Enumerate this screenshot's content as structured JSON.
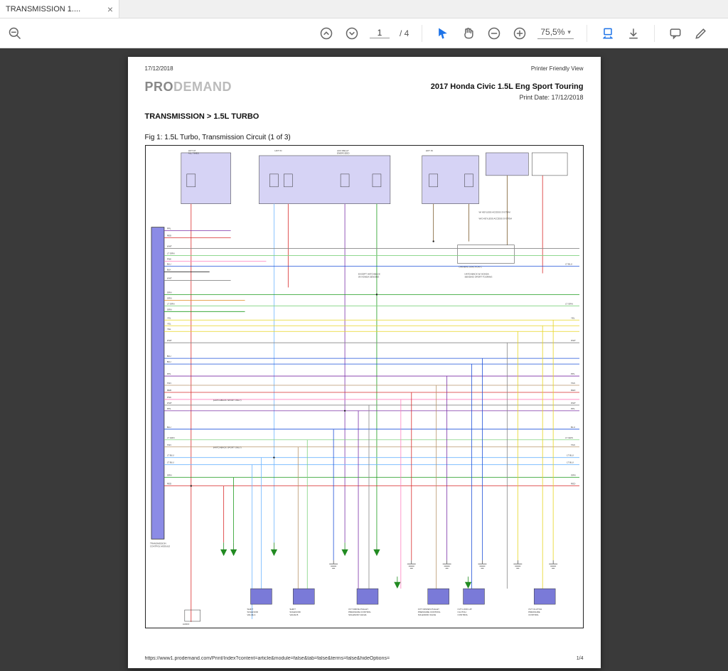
{
  "tab": {
    "label": "TRANSMISSION 1...."
  },
  "toolbar": {
    "page_current": "1",
    "page_total": "/ 4",
    "zoom": "75,5%"
  },
  "doc": {
    "date_top_left": "17/12/2018",
    "view_label": "Printer Friendly View",
    "brand_pro": "PRO",
    "brand_demand": "DEMAND",
    "vehicle": "2017 Honda Civic 1.5L Eng Sport Touring",
    "print_date": "Print Date: 17/12/2018",
    "section": "TRANSMISSION > 1.5L TURBO",
    "fig_title": "Fig 1: 1.5L Turbo, Transmission Circuit (1 of 3)",
    "footer_url": "https://www1.prodemand.com/Print/Index?content=article&module=false&tab=false&terms=false&hideOptions=",
    "footer_page": "1/4"
  },
  "diagram": {
    "top_labels": [
      "HOT AT ALL TIMES",
      "HOT IN",
      "ACC RELAY ENERGIZED",
      "HOT IN"
    ],
    "pcm_label": "TRANSMISSION CONTROL MODULE",
    "wire_colors": [
      "PPL",
      "RED",
      "WHT",
      "LT GRN",
      "PNK",
      "BLU",
      "BLK",
      "WHT",
      "GRN",
      "ORN",
      "LT GRN",
      "GRN",
      "YEL",
      "YEL",
      "YEL",
      "WHT",
      "BLU",
      "BLU",
      "PPL",
      "TAN",
      "RED",
      "PNK",
      "WHT",
      "PPL",
      "BLU",
      "LT GRN",
      "TAN",
      "LT BLU",
      "LT BLU",
      "GRN",
      "RED"
    ],
    "right_labels": [
      "LT GRN",
      "LT BLU",
      "GRN",
      "YEL",
      "YEL",
      "WHT",
      "PNK",
      "PPL",
      "TAN",
      "BLU",
      "RED",
      "WHT",
      "PPL",
      "BLU",
      "LT GRN",
      "TAN",
      "LT BLU",
      "LT BLU",
      "GRN",
      "RED"
    ],
    "bottom_components": [
      "SHIFT SOLENOID VALVE A",
      "SHIFT SOLENOID VALVE B",
      "CVT DRIVE PULLEY PRESSURE CONTROL",
      "CVT DRIVEN PULLEY PRESSURE CONTROL",
      "CVT LOCK-UP CLUTCH CONTROL",
      "CVT CLUTCH PRESSURE CONTROL"
    ],
    "note_hatchback": "(HATCHBACK SPORT ONLY)",
    "note_except": "EXCEPT HATCHBACK W/ HONDA SENSING",
    "keyless": "W/ KEYLESS ACCESS SYSTEM",
    "no_keyless": "W/O KEYLESS ACCESS SYSTEM"
  },
  "colors": {
    "ppl": "#7b2fa6",
    "red": "#d92b2b",
    "wht": "#888",
    "ltgrn": "#7fd27f",
    "pnk": "#ff7fbf",
    "blu": "#1e50d9",
    "blk": "#111",
    "grn": "#1e9c1e",
    "orn": "#e08a1e",
    "yel": "#e6d520",
    "tan": "#b8956b",
    "ltblu": "#6fb6ff",
    "brn": "#7a5a2b"
  }
}
